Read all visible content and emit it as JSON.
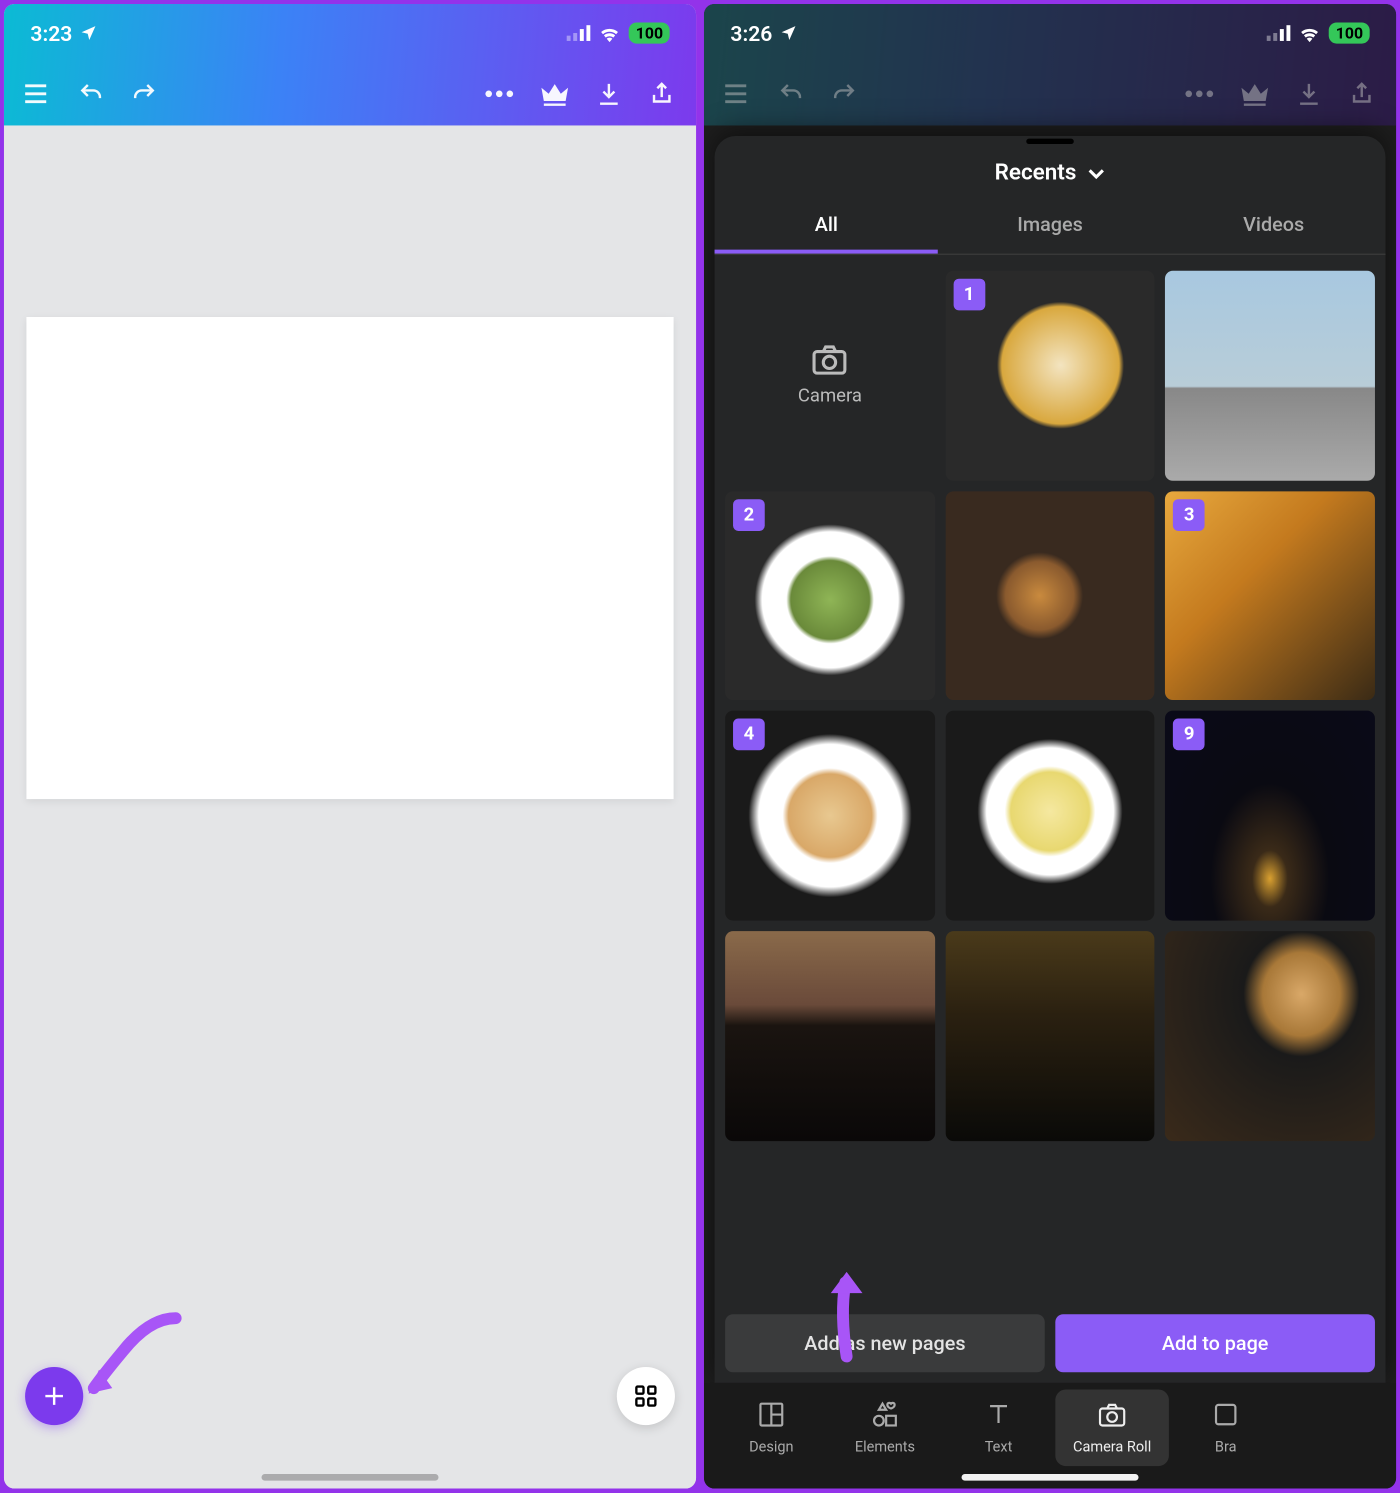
{
  "left": {
    "status": {
      "time": "3:23",
      "battery": "100"
    },
    "canvas": {}
  },
  "right": {
    "status": {
      "time": "3:26",
      "battery": "100"
    },
    "panel": {
      "title": "Recents",
      "tabs": [
        "All",
        "Images",
        "Videos"
      ],
      "active_tab": 0,
      "camera_label": "Camera",
      "thumbs": [
        {
          "sel": "1",
          "class": "th-starbucks"
        },
        {
          "sel": null,
          "class": "th-city-day"
        },
        {
          "sel": "2",
          "class": "th-pasta"
        },
        {
          "sel": null,
          "class": "th-burger"
        },
        {
          "sel": "3",
          "class": "th-bread"
        },
        {
          "sel": "4",
          "class": "th-shrimp"
        },
        {
          "sel": null,
          "class": "th-soup"
        },
        {
          "sel": "9",
          "class": "th-night"
        },
        {
          "sel": null,
          "class": "th-dusk"
        },
        {
          "sel": null,
          "class": "th-dark"
        },
        {
          "sel": null,
          "class": "th-food"
        }
      ],
      "actions": {
        "secondary": "Add as new pages",
        "primary": "Add to page"
      }
    },
    "nav": [
      {
        "label": "Design",
        "active": false
      },
      {
        "label": "Elements",
        "active": false
      },
      {
        "label": "Text",
        "active": false
      },
      {
        "label": "Camera Roll",
        "active": true
      },
      {
        "label": "Bra",
        "active": false
      }
    ]
  }
}
